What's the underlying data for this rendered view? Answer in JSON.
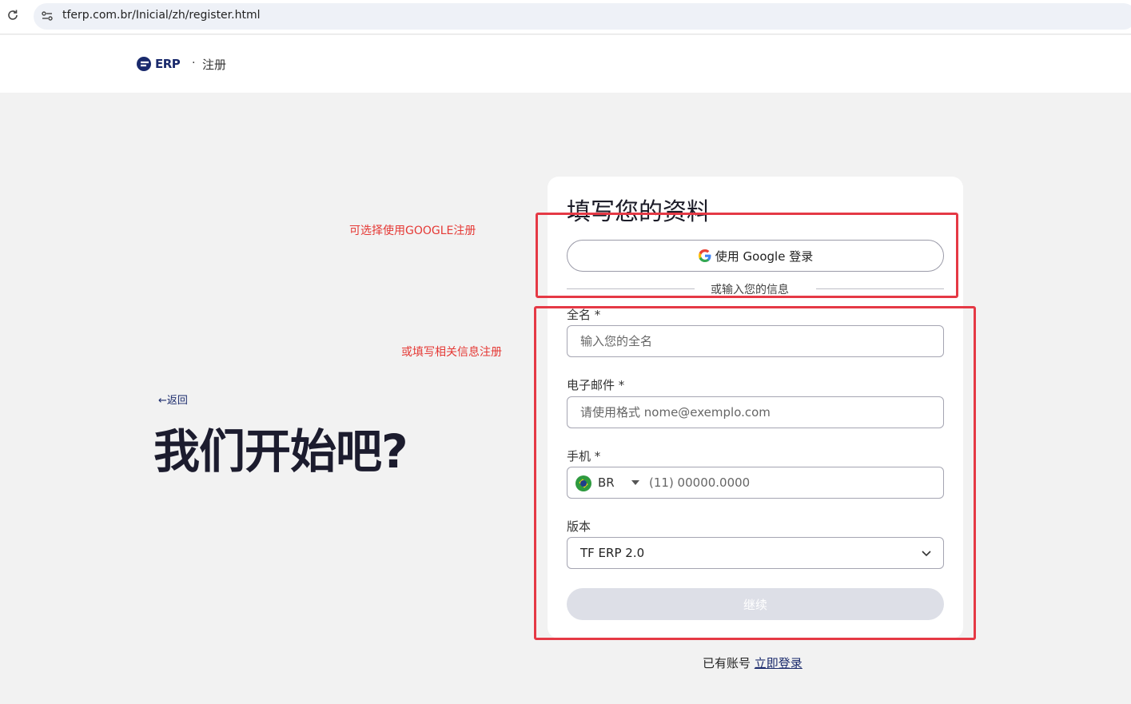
{
  "browser": {
    "url": "tferp.com.br/Inicial/zh/register.html"
  },
  "header": {
    "logo_text": "ERP",
    "separator": "·",
    "title": "注册"
  },
  "annotations": {
    "google_note": "可选择使用GOOGLE注册",
    "form_note": "或填写相关信息注册",
    "color": "#e53935"
  },
  "left": {
    "back_label": "←返回",
    "hero": "我们开始吧?"
  },
  "form": {
    "title": "填写您的资料",
    "google_button": "使用 Google 登录",
    "divider": "或输入您的信息",
    "fullname": {
      "label": "全名 *",
      "placeholder": "输入您的全名"
    },
    "email": {
      "label": "电子邮件 *",
      "placeholder": "请使用格式 nome@exemplo.com"
    },
    "phone": {
      "label": "手机 *",
      "country": "BR",
      "placeholder": "(11) 00000.0000"
    },
    "version": {
      "label": "版本",
      "value": "TF ERP 2.0"
    },
    "continue": "继续"
  },
  "footer": {
    "prompt": "已有账号",
    "login_link": "立即登录"
  }
}
